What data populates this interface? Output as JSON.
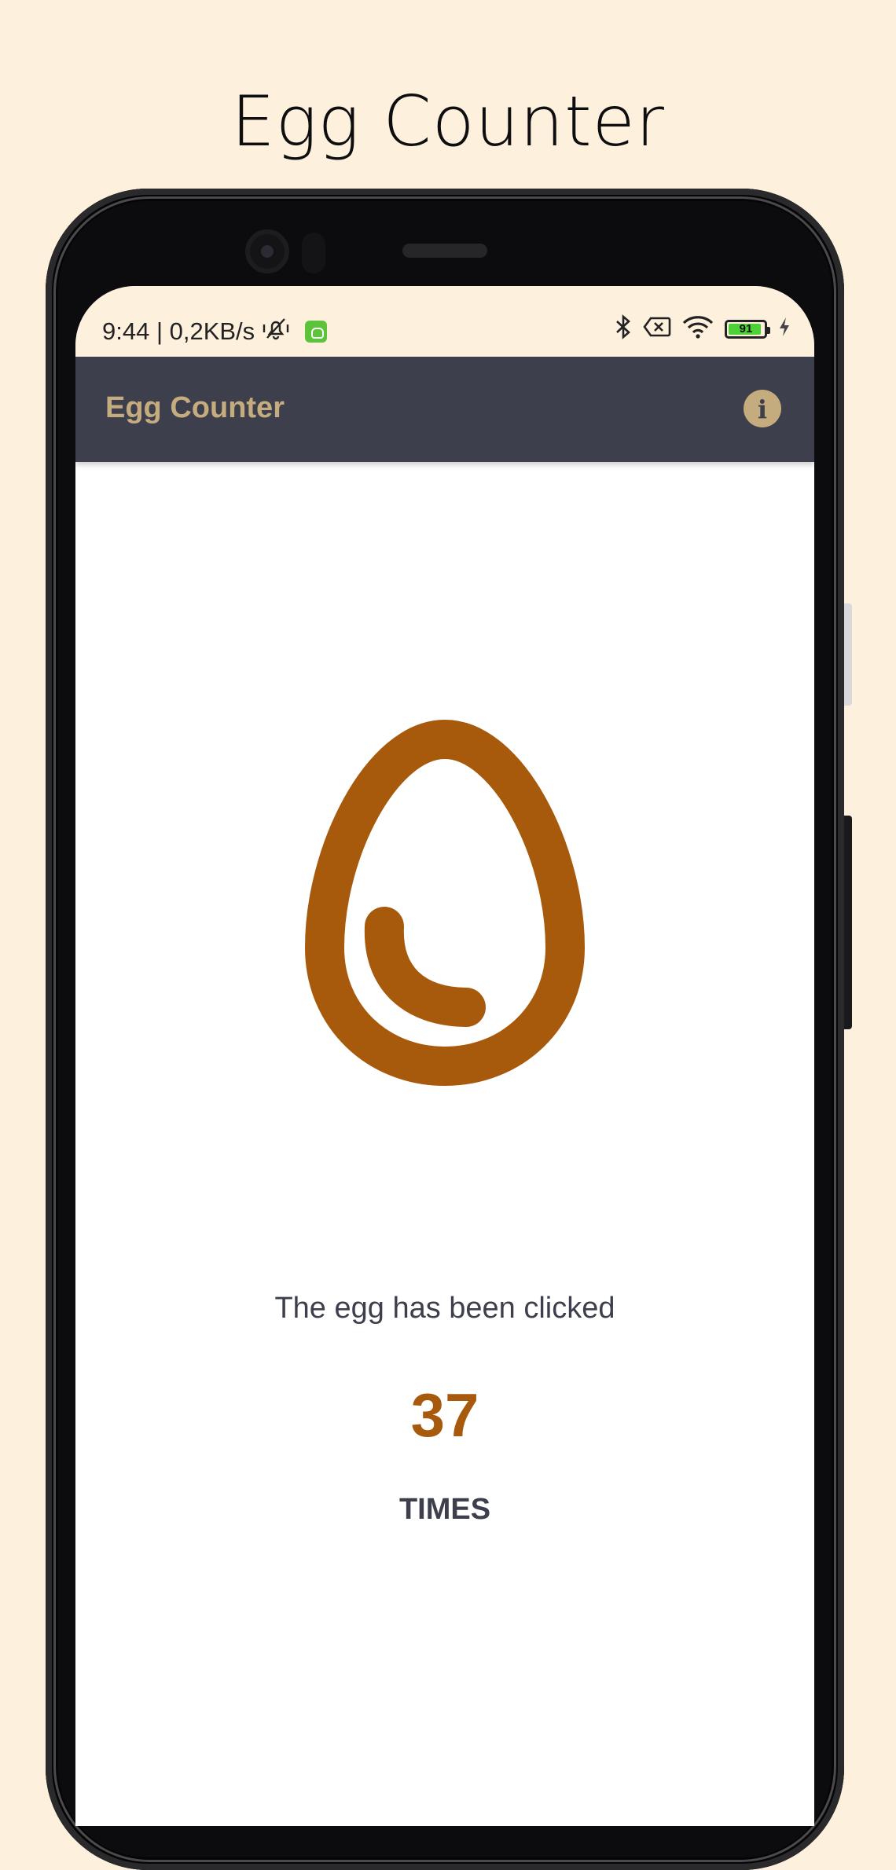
{
  "promo": {
    "title": "Egg Counter"
  },
  "status_bar": {
    "left_text": "9:44 | 0,2KB/s",
    "battery_level": "91",
    "icons": [
      "mute-bell-icon",
      "app-notification-icon",
      "bluetooth-icon",
      "no-sim-icon",
      "wifi-icon",
      "battery-icon",
      "charging-icon"
    ]
  },
  "app_bar": {
    "title": "Egg Counter",
    "info_icon": "i"
  },
  "main": {
    "egg_icon": "egg-icon",
    "caption": "The egg has been clicked",
    "count": "37",
    "times_label": "TIMES"
  },
  "colors": {
    "background": "#fdf1de",
    "app_bar": "#3d3f4c",
    "accent": "#c5ac7e",
    "egg": "#a85a0c"
  }
}
